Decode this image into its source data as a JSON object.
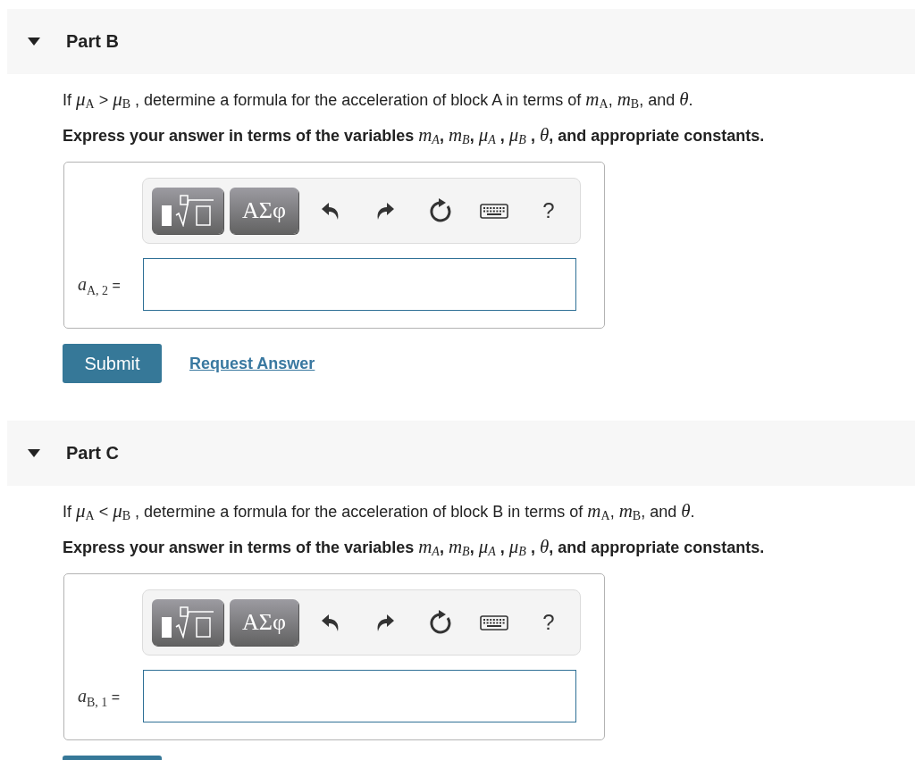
{
  "parts": [
    {
      "title": "Part B",
      "expanded": true,
      "question": "If *μ*$_{A}$ > *μ*$_{B}$ , determine a formula for the acceleration of block A in terms of *m*$_{A}$, *m*$_{B}$, and *θ*.",
      "instruction": "Express your answer in terms of the variables *m*$_{A}$, *m*$_{B}$, *μ*$_{A}$ , *μ*$_{B}$ , *θ*, and appropriate constants.",
      "toolbar": [
        {
          "kind": "template"
        },
        {
          "kind": "symbols",
          "label": "ΑΣφ"
        },
        {
          "kind": "undo"
        },
        {
          "kind": "redo"
        },
        {
          "kind": "reset"
        },
        {
          "kind": "keyboard"
        },
        {
          "kind": "help",
          "label": "?"
        }
      ],
      "answer_label": "*a*$_{A, 2}$ =",
      "actions": {
        "kind": "full",
        "submit": "Submit",
        "request_answer": "Request Answer"
      }
    },
    {
      "title": "Part C",
      "expanded": true,
      "question": "If *μ*$_{A}$ < *μ*$_{B}$ , determine a formula for the acceleration of block B in terms of *m*$_{A}$, *m*$_{B}$, and *θ*.",
      "instruction": "Express your answer in terms of the variables *m*$_{A}$, *m*$_{B}$, *μ*$_{A}$ , *μ*$_{B}$ , *θ*, and appropriate constants.",
      "toolbar": [
        {
          "kind": "template"
        },
        {
          "kind": "symbols",
          "label": "ΑΣφ"
        },
        {
          "kind": "undo"
        },
        {
          "kind": "redo"
        },
        {
          "kind": "reset"
        },
        {
          "kind": "keyboard"
        },
        {
          "kind": "help",
          "label": "?"
        }
      ],
      "answer_label": "*a*$_{B, 1}$ =",
      "actions": {
        "kind": "cut_off"
      }
    }
  ]
}
